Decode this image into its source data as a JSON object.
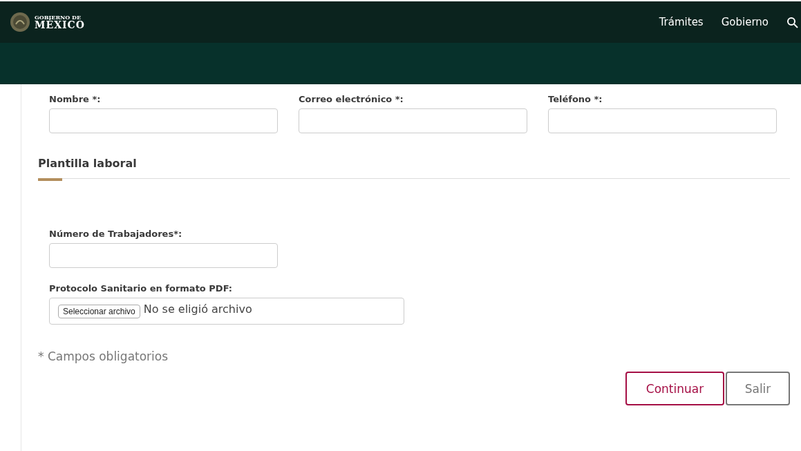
{
  "header": {
    "logo_line1": "GOBIERNO DE",
    "logo_line2": "MÉXICO",
    "nav": [
      "Trámites",
      "Gobierno"
    ]
  },
  "contact_fields": [
    {
      "label": "Nombre *:"
    },
    {
      "label": "Correo electrónico *:"
    },
    {
      "label": "Teléfono *:"
    }
  ],
  "section": {
    "title": "Plantilla laboral"
  },
  "workers_field": {
    "label": "Número de Trabajadores*:"
  },
  "file_field": {
    "label": "Protocolo Sanitario en formato PDF:",
    "button": "Seleccionar archivo",
    "status": "No se eligió archivo"
  },
  "required_note": "* Campos obligatorios",
  "buttons": [
    {
      "label": "Continuar",
      "kind": "primary"
    },
    {
      "label": "Salir",
      "kind": "secondary"
    }
  ]
}
